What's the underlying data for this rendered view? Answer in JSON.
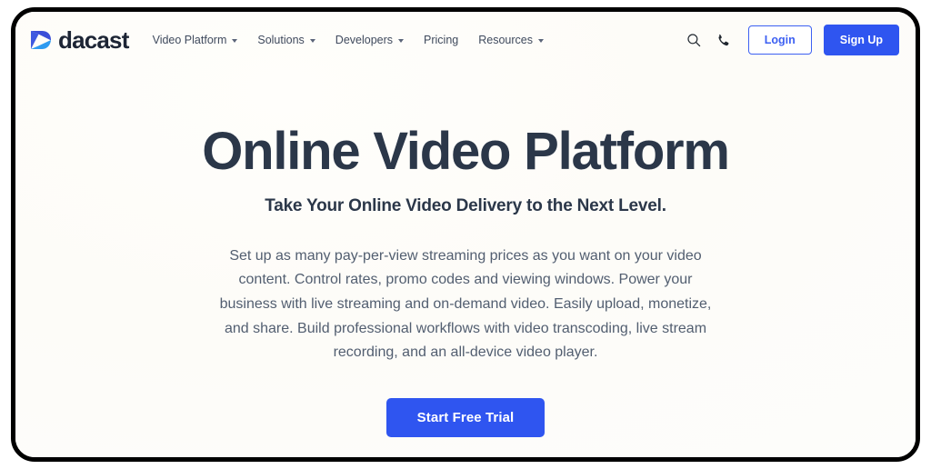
{
  "brand": {
    "name": "dacast",
    "logo_icon": "play-arrow-logo-icon",
    "logo_color_dark": "#3b4fd8",
    "logo_color_light": "#2e9bf0",
    "wordmark_color": "#1d2535"
  },
  "header": {
    "nav": [
      {
        "label": "Video Platform",
        "has_dropdown": true
      },
      {
        "label": "Solutions",
        "has_dropdown": true
      },
      {
        "label": "Developers",
        "has_dropdown": true
      },
      {
        "label": "Pricing",
        "has_dropdown": false
      },
      {
        "label": "Resources",
        "has_dropdown": true
      }
    ],
    "search_icon": "search-icon",
    "phone_icon": "phone-icon",
    "login_label": "Login",
    "signup_label": "Sign Up"
  },
  "hero": {
    "title": "Online Video Platform",
    "subtitle": "Take Your Online Video Delivery to the Next Level.",
    "body": "Set up as many pay-per-view streaming prices as you want on your video content. Control rates, promo codes and viewing windows. Power your business with live streaming and on-demand video. Easily upload, monetize, and share. Build professional workflows with video transcoding, live stream recording, and an all-device video player.",
    "cta_label": "Start Free Trial"
  },
  "colors": {
    "accent_blue": "#2f55f0",
    "login_border_blue": "#3d60f2",
    "heading_navy": "#2b3749",
    "body_text": "#525e70",
    "nav_text": "#3f4a5d",
    "page_background": "#fdfcfa",
    "frame_black": "#000000"
  }
}
